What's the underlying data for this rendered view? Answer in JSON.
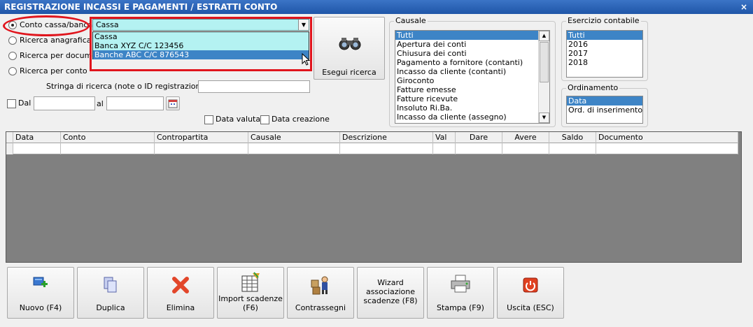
{
  "window": {
    "title": "REGISTRAZIONE INCASSI E PAGAMENTI / ESTRATTI CONTO",
    "close_label": "×"
  },
  "search_mode": {
    "options": [
      {
        "label": "Conto cassa/banca",
        "selected": true
      },
      {
        "label": "Ricerca anagrafica",
        "selected": false
      },
      {
        "label": "Ricerca per documento",
        "selected": false
      },
      {
        "label": "Ricerca per conto",
        "selected": false
      }
    ]
  },
  "account_combo": {
    "value": "Cassa",
    "options": [
      "Cassa",
      "Banca XYZ C/C 123456",
      "Banche ABC C/C 876543"
    ],
    "highlighted": "Banche ABC C/C 876543"
  },
  "search_string": {
    "label": "Stringa di ricerca (note o ID registrazione) :",
    "value": ""
  },
  "date_filter": {
    "from_label": "Dal",
    "to_label": "al",
    "from_value": "",
    "to_value": "",
    "data_valuta_label": "Data valuta",
    "data_creazione_label": "Data creazione"
  },
  "search_button": {
    "label": "Esegui ricerca"
  },
  "causale": {
    "title": "Causale",
    "items": [
      "Tutti",
      "Apertura dei conti",
      "Chiusura dei conti",
      "Pagamento a fornitore (contanti)",
      "Incasso da cliente (contanti)",
      "Giroconto",
      "Fatture emesse",
      "Fatture ricevute",
      "Insoluto Ri.Ba.",
      "Incasso da cliente (assegno)"
    ],
    "selected": "Tutti"
  },
  "esercizio": {
    "title": "Esercizio contabile",
    "items": [
      "Tutti",
      "2016",
      "2017",
      "2018"
    ],
    "selected": "Tutti"
  },
  "ordinamento": {
    "title": "Ordinamento",
    "items": [
      "Data",
      "Ord. di inserimento"
    ],
    "selected": "Data"
  },
  "grid": {
    "columns": [
      "Data",
      "Conto",
      "Contropartita",
      "Causale",
      "Descrizione",
      "Val",
      "Dare",
      "Avere",
      "Saldo",
      "Documento"
    ]
  },
  "toolbar": {
    "new": "Nuovo (F4)",
    "duplicate": "Duplica",
    "delete": "Elimina",
    "import_line1": "Import scadenze",
    "import_line2": "(F6)",
    "cod": "Contrassegni",
    "wizard_line1": "Wizard",
    "wizard_line2": "associazione",
    "wizard_line3": "scadenze (F8)",
    "print": "Stampa (F9)",
    "exit": "Uscita (ESC)"
  }
}
